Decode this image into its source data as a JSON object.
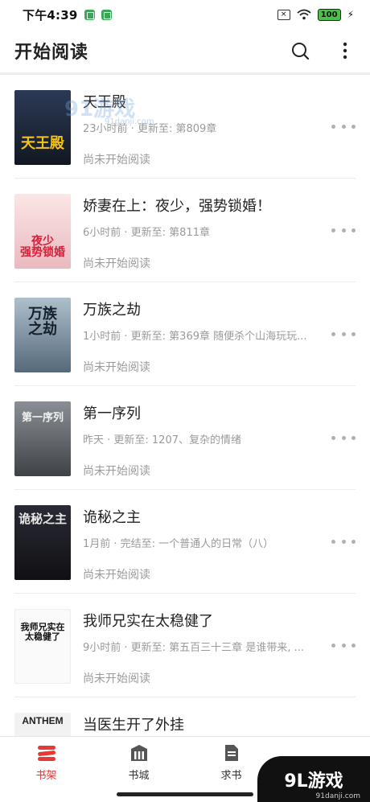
{
  "status_bar": {
    "time": "下午4:39",
    "battery": "100"
  },
  "app_bar": {
    "title": "开始阅读"
  },
  "books": [
    {
      "title": "天王殿",
      "update": "23小时前 · 更新至: 第809章",
      "status": "尚未开始阅读",
      "cover_text": "天王殿",
      "cover_bg": "#1c2434",
      "cover_fg": "#f5c21a"
    },
    {
      "title": "娇妻在上：夜少，强势锁婚！",
      "update": "6小时前 · 更新至: 第811章",
      "status": "尚未开始阅读",
      "cover_text": "夜少\n强势锁婚",
      "cover_bg": "#f2d4d4",
      "cover_fg": "#d4213b"
    },
    {
      "title": "万族之劫",
      "update": "1小时前 · 更新至: 第369章 随便杀个山海玩玩...",
      "status": "尚未开始阅读",
      "cover_text": "万族\n之劫",
      "cover_bg": "#7f95a6",
      "cover_fg": "#14212c"
    },
    {
      "title": "第一序列",
      "update": "昨天 · 更新至: 1207、复杂的情绪",
      "status": "尚未开始阅读",
      "cover_text": "第一序列",
      "cover_bg": "#6b6f74",
      "cover_fg": "#f0f0f0"
    },
    {
      "title": "诡秘之主",
      "update": "1月前 · 完结至: 一个普通人的日常（八）",
      "status": "尚未开始阅读",
      "cover_text": "诡秘之主",
      "cover_bg": "#1b1b22",
      "cover_fg": "#e8e8e8"
    },
    {
      "title": "我师兄实在太稳健了",
      "update": "9小时前 · 更新至: 第五百三十三章 是谁带来, ...",
      "status": "尚未开始阅读",
      "cover_text": "我师兄实在\n太稳健了",
      "cover_bg": "#fafafa",
      "cover_fg": "#111111"
    },
    {
      "title": "当医生开了外挂",
      "update": "",
      "status": "",
      "cover_text": "ANTHEM",
      "cover_bg": "#f2f2f2",
      "cover_fg": "#222222"
    }
  ],
  "bottom_nav": [
    {
      "label": "书架",
      "icon": "bookshelf-icon",
      "active": true
    },
    {
      "label": "书城",
      "icon": "bookstore-icon",
      "active": false
    },
    {
      "label": "求书",
      "icon": "request-book-icon",
      "active": false
    },
    {
      "label": "",
      "icon": "profile-icon",
      "active": false
    }
  ],
  "watermark": {
    "main": "9L游戏",
    "sub": "91danji.com",
    "overlay": "91游戏",
    "overlay_sub": "91danji.com"
  },
  "colors": {
    "accent": "#e53935",
    "muted_text": "#9a9a9a",
    "divider": "#ececec"
  }
}
